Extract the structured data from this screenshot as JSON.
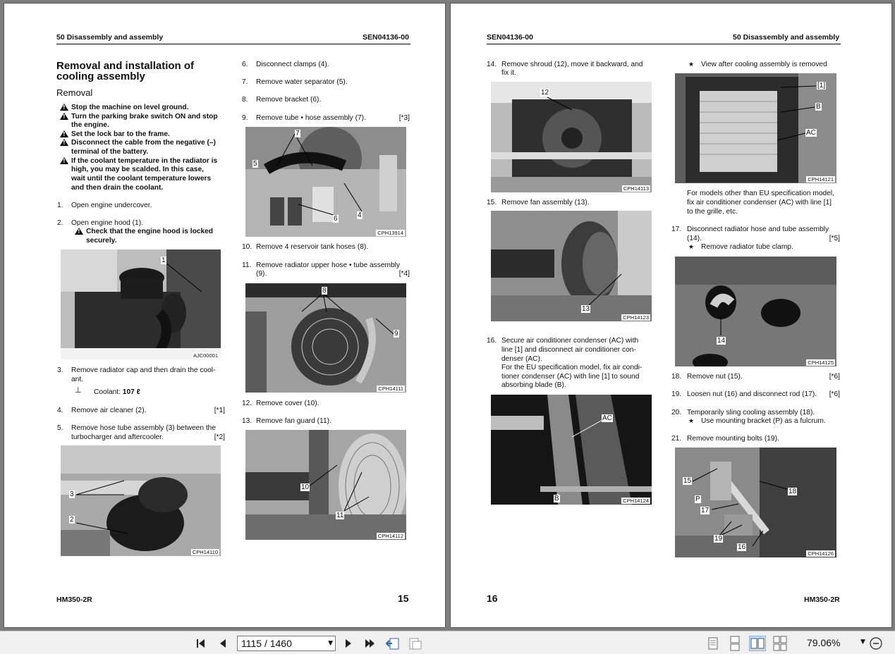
{
  "left_page": {
    "header_left": "50 Disassembly and assembly",
    "header_right": "SEN04136-00",
    "title_line1": "Removal and installation of",
    "title_line2": "cooling assembly",
    "subtitle": "Removal",
    "warnings": [
      [
        "Stop the machine on level ground."
      ],
      [
        "Turn the parking brake switch ON and stop",
        "the engine."
      ],
      [
        "Set the lock bar to the frame."
      ],
      [
        "Disconnect the cable from the negative (–)",
        "terminal of the battery."
      ],
      [
        "If the coolant temperature in the radiator is",
        "high, you may be scalded.  In this case,",
        "wait until the coolant temperature lowers",
        "and then drain the coolant."
      ]
    ],
    "step1": {
      "num": "1.",
      "text": "Open engine undercover."
    },
    "step2": {
      "num": "2.",
      "text": "Open engine hood (1).",
      "caution1": "Check that the engine hood is locked",
      "caution2": "securely."
    },
    "fig1": {
      "code": "AJC00001",
      "callout": "1"
    },
    "step3": {
      "num": "3.",
      "line1": "Remove radiator cap and then drain the cool-",
      "line2": "ant.",
      "coolant_label": "Coolant: ",
      "coolant_value": "107 ℓ"
    },
    "step4": {
      "num": "4.",
      "text": "Remove air cleaner (2).",
      "ref": "[*1]"
    },
    "step5": {
      "num": "5.",
      "line1": "Remove hose tube assembly (3) between the",
      "line2": "turbocharger and aftercooler.",
      "ref": "[*2]"
    },
    "fig2": {
      "code": "CPH14110",
      "c3": "3",
      "c2": "2"
    },
    "step6": {
      "num": "6.",
      "text": "Disconnect clamps (4)."
    },
    "step7": {
      "num": "7.",
      "text": "Remove water separator (5)."
    },
    "step8": {
      "num": "8.",
      "text": "Remove bracket (6)."
    },
    "step9": {
      "num": "9.",
      "text": "Remove tube • hose assembly (7).",
      "ref": "[*3]"
    },
    "fig3": {
      "code": "CPH13914",
      "c7": "7",
      "c5": "5",
      "c4": "4",
      "c6": "6"
    },
    "step10": {
      "num": "10.",
      "text": "Remove 4 reservoir tank hoses (8)."
    },
    "step11": {
      "num": "11.",
      "line1": "Remove radiator upper hose • tube assembly",
      "line2": "(9).",
      "ref": "[*4]"
    },
    "fig4": {
      "code": "CPH14111",
      "c8": "8",
      "c9": "9"
    },
    "step12": {
      "num": "12.",
      "text": "Remove cover (10)."
    },
    "step13": {
      "num": "13.",
      "text": "Remove fan guard (11)."
    },
    "fig5": {
      "code": "CPH14112",
      "c10": "10",
      "c11": "11"
    },
    "footer_model": "HM350-2R",
    "footer_page": "15"
  },
  "right_page": {
    "header_left": "SEN04136-00",
    "header_right": "50 Disassembly and assembly",
    "step14": {
      "num": "14.",
      "line1": "Remove shroud (12), move it backward, and",
      "line2": "fix it."
    },
    "fig6": {
      "code": "CPH14113",
      "c12": "12"
    },
    "step15": {
      "num": "15.",
      "text": "Remove fan assembly (13)."
    },
    "fig7": {
      "code": "CPH14123",
      "c13": "13"
    },
    "step16": {
      "num": "16.",
      "lines": [
        "Secure air conditioner condenser (AC) with",
        "line [1] and disconnect air conditioner con-",
        "denser (AC).",
        "For the EU specification model, fix air condi-",
        "tioner condenser (AC) with line [1] to sound",
        "absorbing blade (B)."
      ]
    },
    "fig8": {
      "code": "CPH14124",
      "cAC": "AC",
      "cB": "B"
    },
    "view_note": "View after cooling assembly is removed",
    "fig9": {
      "code": "CPH14121",
      "c1": "[1]",
      "cB": "B",
      "cAC": "AC"
    },
    "other_models": [
      "For models other than EU specification model,",
      "fix air conditioner condenser (AC) with line [1]",
      "to the grille, etc."
    ],
    "step17": {
      "num": "17.",
      "line1": "Disconnect radiator hose and tube assembly",
      "line2": "(14).",
      "ref": "[*5]",
      "note": "Remove radiator tube clamp."
    },
    "fig10": {
      "code": "CPH14125",
      "c14": "14"
    },
    "step18": {
      "num": "18.",
      "text": "Remove nut (15).",
      "ref": "[*6]"
    },
    "step19": {
      "num": "19.",
      "text": "Loosen nut (16) and disconnect rod (17).",
      "ref": "[*6]"
    },
    "step20": {
      "num": "20.",
      "text": "Temporarily sling cooling assembly (18).",
      "note": "Use mounting bracket (P) as a fulcrum."
    },
    "step21": {
      "num": "21.",
      "text": "Remove mounting bolts (19)."
    },
    "fig11": {
      "code": "CPH14126",
      "c15": "15",
      "cP": "P",
      "c17": "17",
      "c18": "18",
      "c19": "19",
      "c16": "16"
    },
    "footer_page": "16",
    "footer_model": "HM350-2R"
  },
  "toolbar": {
    "page_indicator": "1115 / 1460",
    "zoom": "79.06%",
    "icons": [
      "first-page-icon",
      "prev-page-icon",
      "next-page-icon",
      "last-page-icon",
      "previous-view-icon",
      "next-view-icon",
      "single-page-icon",
      "continuous-icon",
      "facing-pages-icon",
      "continuous-facing-icon",
      "zoom-out-icon"
    ]
  }
}
